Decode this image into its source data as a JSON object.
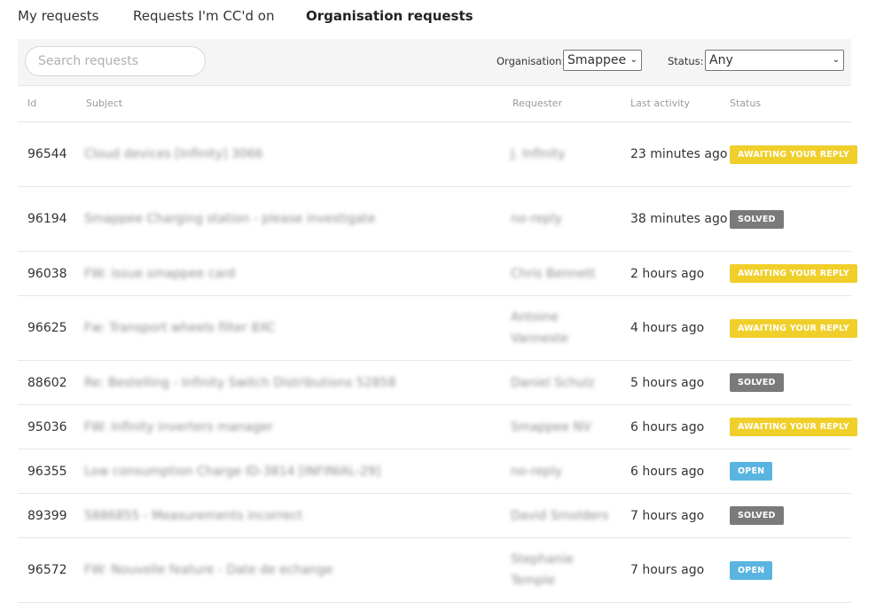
{
  "tabs": [
    {
      "label": "My requests"
    },
    {
      "label": "Requests I'm CC'd on"
    },
    {
      "label": "Organisation requests"
    }
  ],
  "filters": {
    "search_placeholder": "Search requests",
    "organisation_label": "Organisation:",
    "organisation_value": "Smappee",
    "status_label": "Status:",
    "status_value": "Any"
  },
  "columns": {
    "id": "Id",
    "subject": "Subject",
    "requester": "Requester",
    "last_activity": "Last activity",
    "status": "Status"
  },
  "status_labels": {
    "awaiting": "AWAITING YOUR REPLY",
    "solved": "SOLVED",
    "open": "OPEN"
  },
  "status_colors": {
    "awaiting": "#f0cf2a",
    "solved": "#7a7a7a",
    "open": "#5ab4e0"
  },
  "rows": [
    {
      "id": "96544",
      "subject": "Cloud devices [Infinity] 3066",
      "requester": "J. Infinity",
      "last_activity": "23 minutes ago",
      "status": "awaiting",
      "status_label": "AWAITING YOUR REPLY"
    },
    {
      "id": "96194",
      "subject": "Smappee Charging station - please investigate",
      "requester": "no-reply",
      "last_activity": "38 minutes ago",
      "status": "solved",
      "status_label": "SOLVED"
    },
    {
      "id": "96038",
      "subject": "FW: issue smappee card",
      "requester": "Chris Bennett",
      "last_activity": "2 hours ago",
      "status": "awaiting",
      "status_label": "AWAITING YOUR REPLY"
    },
    {
      "id": "96625",
      "subject": "Fw: Transport wheels filter 8XC",
      "requester": "Antoine Vanneste",
      "last_activity": "4 hours ago",
      "status": "awaiting",
      "status_label": "AWAITING YOUR REPLY"
    },
    {
      "id": "88602",
      "subject": "Re: Bestelling - Infinity Switch Distributions 52858",
      "requester": "Daniel Schulz",
      "last_activity": "5 hours ago",
      "status": "solved",
      "status_label": "SOLVED"
    },
    {
      "id": "95036",
      "subject": "FW: Infinity inverters manager",
      "requester": "Smappee NV",
      "last_activity": "6 hours ago",
      "status": "awaiting",
      "status_label": "AWAITING YOUR REPLY"
    },
    {
      "id": "96355",
      "subject": "Low consumption Charge ID-3814 [INFINIAL-29]",
      "requester": "no-reply",
      "last_activity": "6 hours ago",
      "status": "open",
      "status_label": "OPEN"
    },
    {
      "id": "89399",
      "subject": "5886855 - Measurements incorrect",
      "requester": "David Smolders",
      "last_activity": "7 hours ago",
      "status": "solved",
      "status_label": "SOLVED"
    },
    {
      "id": "96572",
      "subject": "FW: Nouvelle feature - Date de echange",
      "requester": "Stephanie Temple",
      "last_activity": "7 hours ago",
      "status": "open",
      "status_label": "OPEN"
    }
  ]
}
